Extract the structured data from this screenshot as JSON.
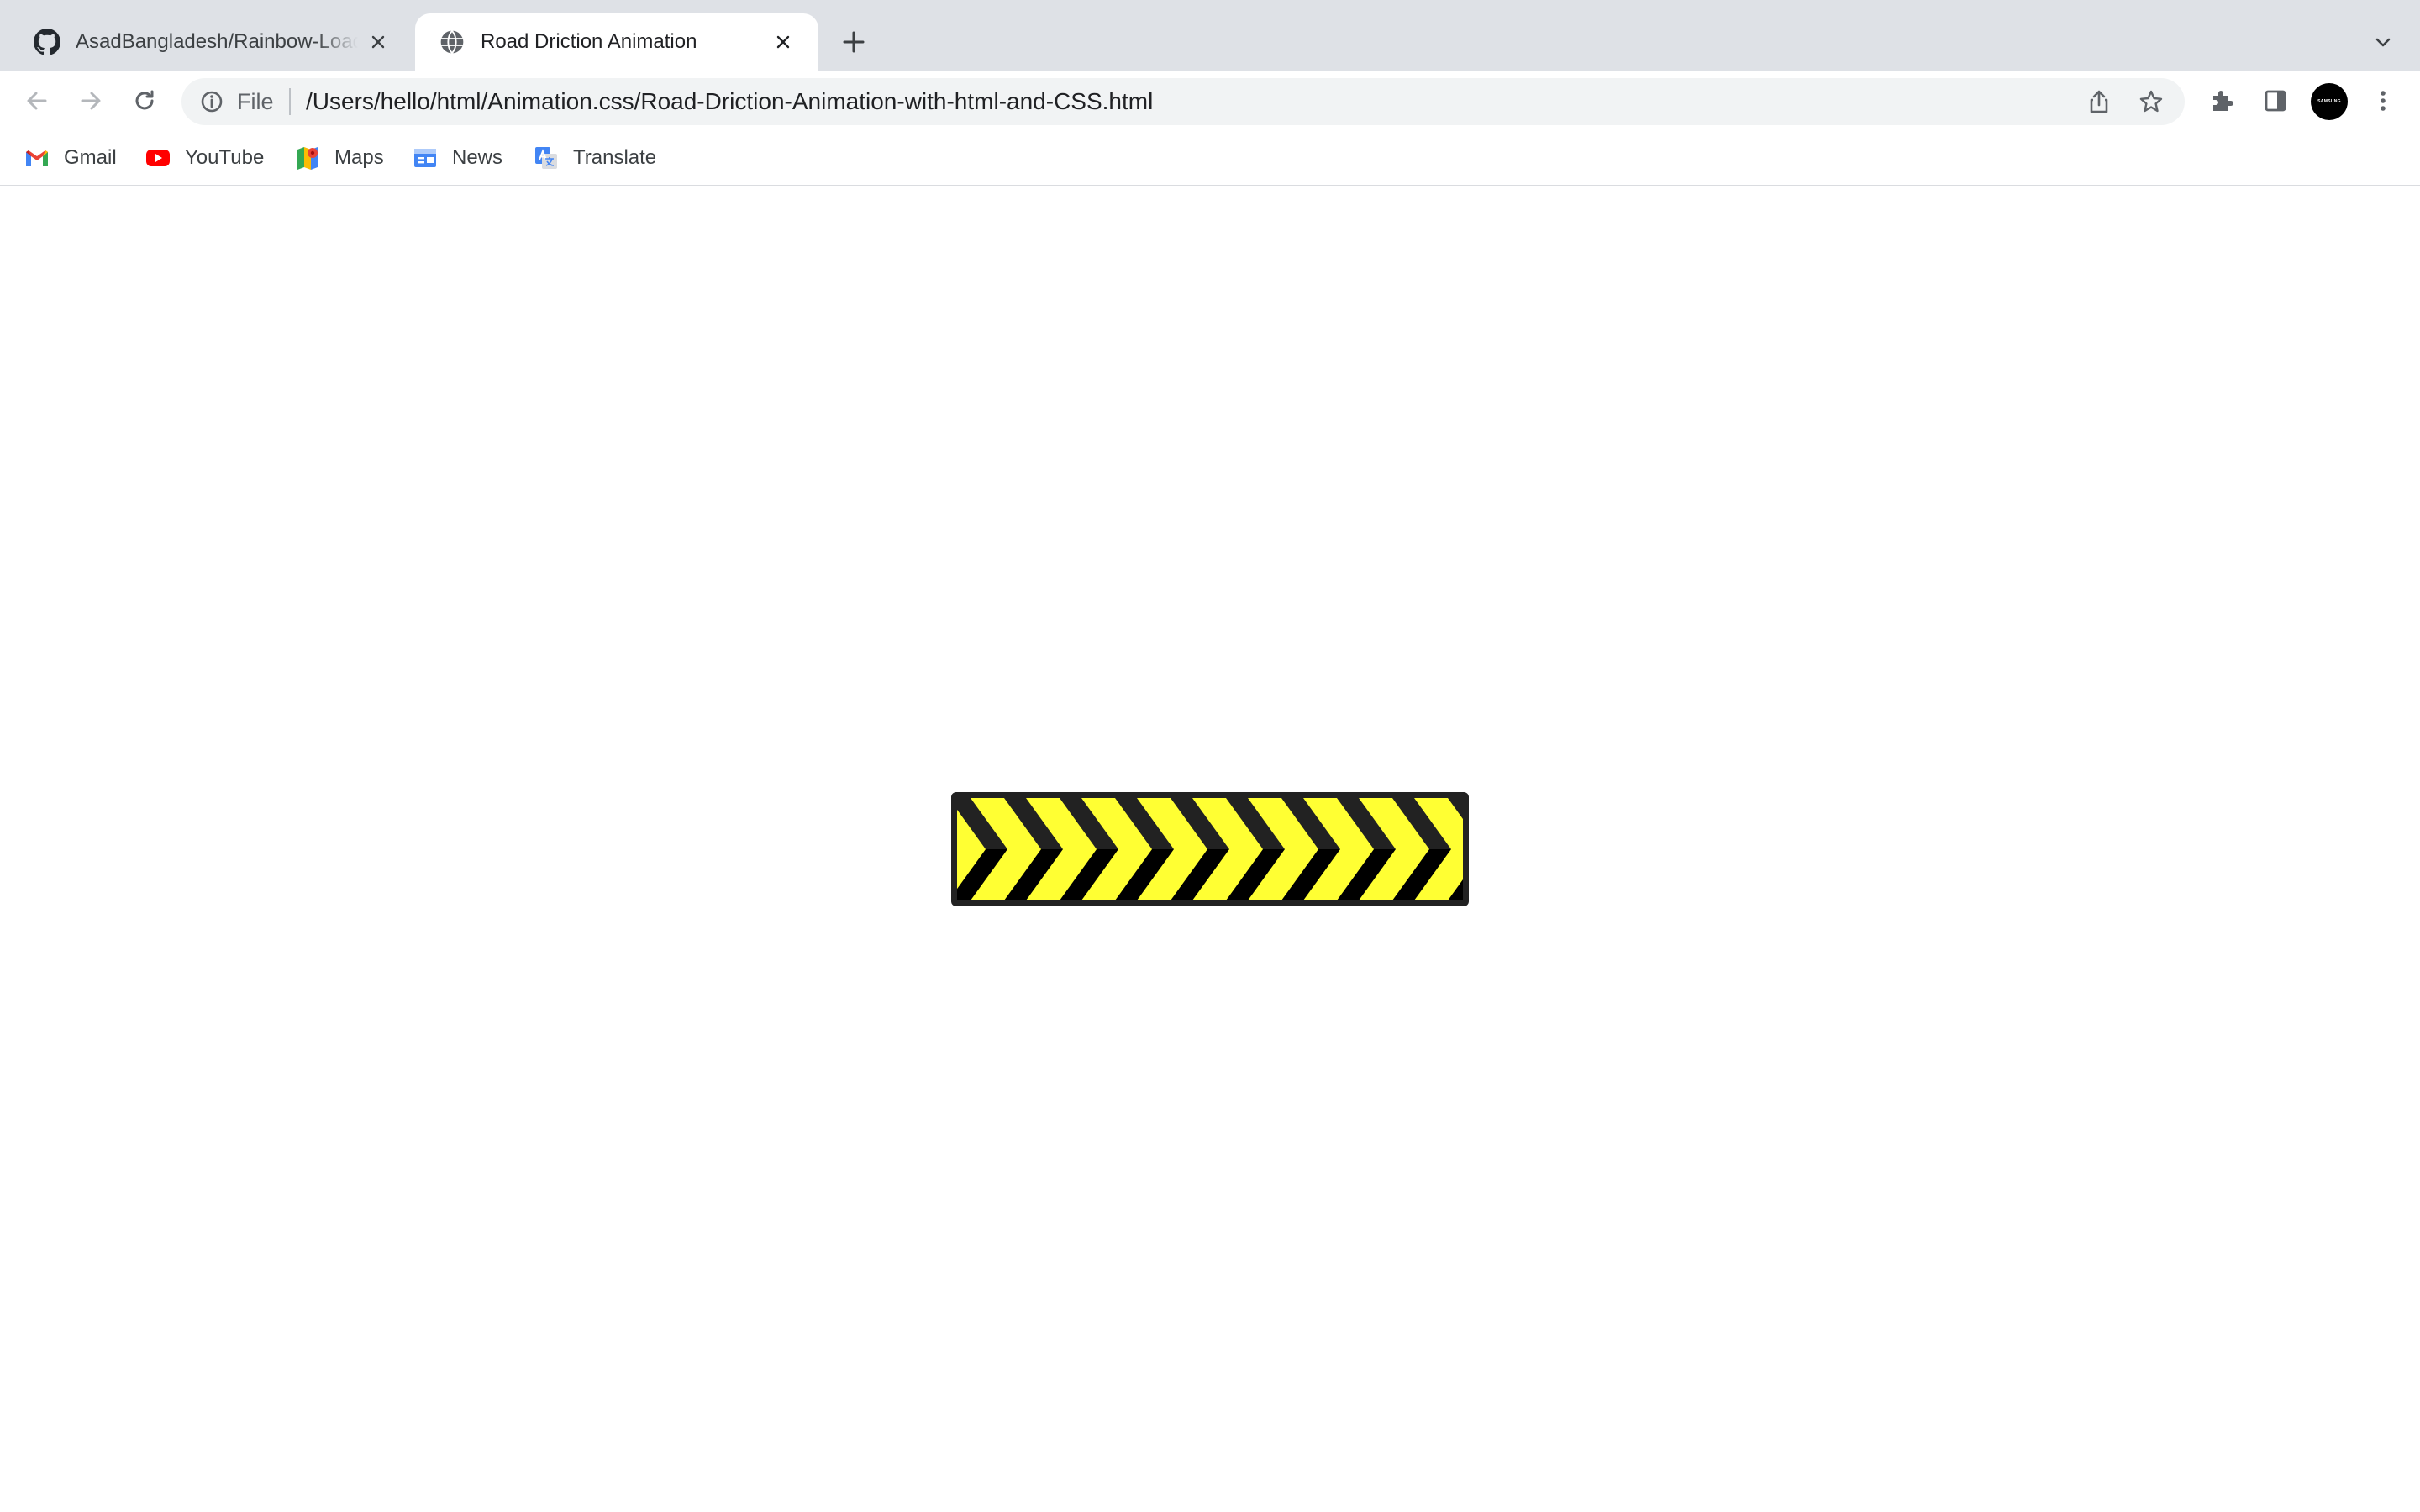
{
  "tabs": [
    {
      "title": "AsadBangladesh/Rainbow-Loader",
      "favicon": "github-icon",
      "active": false
    },
    {
      "title": "Road Driction Animation",
      "favicon": "globe-icon",
      "active": true
    }
  ],
  "toolbar": {
    "scheme_label": "File",
    "url": "/Users/hello/html/Animation.css/Road-Driction-Animation-with-html-and-CSS.html",
    "profile_label": "SAMSUNG"
  },
  "bookmarks": [
    {
      "label": "Gmail",
      "icon": "gmail-icon"
    },
    {
      "label": "YouTube",
      "icon": "youtube-icon"
    },
    {
      "label": "Maps",
      "icon": "maps-icon"
    },
    {
      "label": "News",
      "icon": "news-icon"
    },
    {
      "label": "Translate",
      "icon": "translate-icon"
    }
  ],
  "content": {
    "sign_colors": {
      "stripe": "#ffff33",
      "chevron": "#222222",
      "shadow": "#000000",
      "border": "#222222"
    }
  }
}
